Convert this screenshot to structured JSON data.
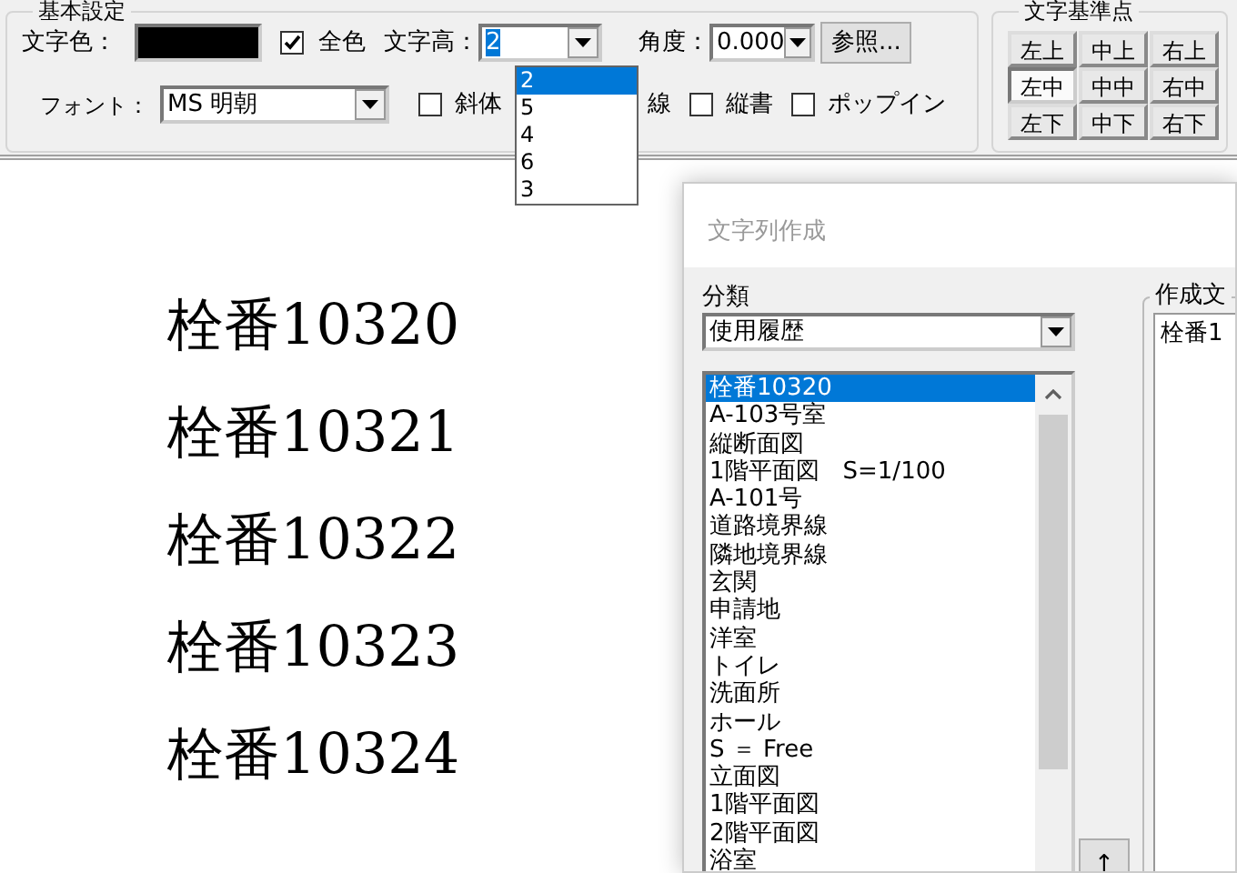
{
  "basic_settings": {
    "title": "基本設定",
    "text_color": {
      "label": "文字色：",
      "color": "#000000"
    },
    "all_colors": {
      "label": "全色",
      "checked": true
    },
    "text_height": {
      "label": "文字高：",
      "value": "2"
    },
    "text_height_options": [
      {
        "label": "2",
        "selected": true
      },
      {
        "label": "5",
        "selected": false
      },
      {
        "label": "4",
        "selected": false
      },
      {
        "label": "6",
        "selected": false
      },
      {
        "label": "3",
        "selected": false
      }
    ],
    "angle": {
      "label": "角度：",
      "value": "0.000"
    },
    "reference_button": "参照...",
    "font": {
      "label": "フォント：",
      "value": "MS 明朝"
    },
    "checkboxes": [
      {
        "kind": "checkbox",
        "label": "斜体",
        "checked": false
      },
      {
        "kind": "covered",
        "label": "線"
      },
      {
        "kind": "checkbox",
        "label": "縦書",
        "checked": false
      },
      {
        "kind": "checkbox",
        "label": "ポップイン",
        "checked": false
      }
    ]
  },
  "reference_point": {
    "title": "文字基準点",
    "buttons": [
      {
        "label": "左上",
        "selected": false
      },
      {
        "label": "中上",
        "selected": false
      },
      {
        "label": "右上",
        "selected": false
      },
      {
        "label": "左中",
        "selected": true
      },
      {
        "label": "中中",
        "selected": false
      },
      {
        "label": "右中",
        "selected": false
      },
      {
        "label": "左下",
        "selected": false
      },
      {
        "label": "中下",
        "selected": false
      },
      {
        "label": "右下",
        "selected": false
      }
    ]
  },
  "canvas": {
    "texts": [
      "栓番10320",
      "栓番10321",
      "栓番10322",
      "栓番10323",
      "栓番10324"
    ]
  },
  "dialog": {
    "title": "文字列作成",
    "category": {
      "label": "分類",
      "value": "使用履歴"
    },
    "history": [
      {
        "label": "栓番10320",
        "selected": true
      },
      {
        "label": "A-103号室",
        "selected": false
      },
      {
        "label": "縦断面図",
        "selected": false
      },
      {
        "label": "1階平面図　S=1/100",
        "selected": false
      },
      {
        "label": "A-101号",
        "selected": false
      },
      {
        "label": "道路境界線",
        "selected": false
      },
      {
        "label": "隣地境界線",
        "selected": false
      },
      {
        "label": "玄関",
        "selected": false
      },
      {
        "label": "申請地",
        "selected": false
      },
      {
        "label": "洋室",
        "selected": false
      },
      {
        "label": "トイレ",
        "selected": false
      },
      {
        "label": "洗面所",
        "selected": false
      },
      {
        "label": "ホール",
        "selected": false
      },
      {
        "label": "S ＝ Free",
        "selected": false
      },
      {
        "label": "立面図",
        "selected": false
      },
      {
        "label": "1階平面図",
        "selected": false
      },
      {
        "label": "2階平面図",
        "selected": false
      },
      {
        "label": "浴室",
        "selected": false
      }
    ],
    "up_button": "↑",
    "result": {
      "title": "作成文",
      "value": "栓番1"
    }
  }
}
